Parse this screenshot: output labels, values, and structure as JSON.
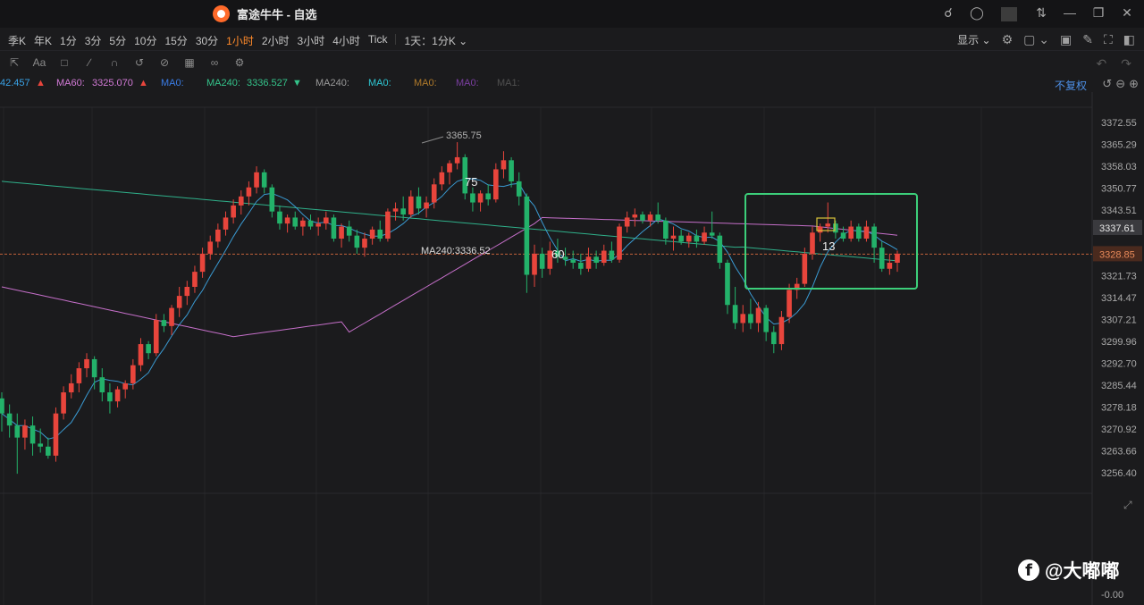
{
  "window": {
    "title": "富途牛牛 - 自选",
    "icons": [
      "headset-icon",
      "shirt-icon",
      "collapse-icon",
      "minimize-icon",
      "restore-icon",
      "close-icon"
    ]
  },
  "toolbar": {
    "timeframes": [
      "季K",
      "年K",
      "1分",
      "3分",
      "5分",
      "10分",
      "15分",
      "30分",
      "1小时",
      "2小时",
      "3小时",
      "4小时",
      "Tick"
    ],
    "active": "1小时",
    "range": "1天：1分K",
    "display": "显示"
  },
  "drawing_tools": [
    "text-icon",
    "comment-icon",
    "pen-icon",
    "magnet-icon",
    "sync-icon",
    "hide-icon",
    "trash-icon",
    "link-icon",
    "settings-icon"
  ],
  "indicators": {
    "items": [
      {
        "text": "42.457",
        "color": "#3aa3e8"
      },
      {
        "text": "▲",
        "color": "#e8453c"
      },
      {
        "text": "MA60:",
        "color": "#d27ad6"
      },
      {
        "text": "3325.070",
        "color": "#d27ad6"
      },
      {
        "text": "▲",
        "color": "#e8453c"
      },
      {
        "text": "MA0:",
        "color": "#3a7de8"
      },
      {
        "text": "MA240:",
        "color": "#34c38a"
      },
      {
        "text": "3336.527",
        "color": "#34c38a"
      },
      {
        "text": "▼",
        "color": "#34c38a"
      },
      {
        "text": "MA240:",
        "color": "#9a9a9a"
      },
      {
        "text": "MA0:",
        "color": "#2ec8d4"
      },
      {
        "text": "MA0:",
        "color": "#b07a2a"
      },
      {
        "text": "MA0:",
        "color": "#7a3ea0"
      },
      {
        "text": "MA1:",
        "color": "#505050"
      }
    ],
    "adjust": "不复权"
  },
  "chart_data": {
    "type": "candlestick",
    "price_axis": [
      "3372.55",
      "3365.29",
      "3358.03",
      "3350.77",
      "3343.51",
      "3337.61",
      "3328.85",
      "3321.73",
      "3314.47",
      "3307.21",
      "3299.96",
      "3292.70",
      "3285.44",
      "3278.18",
      "3270.92",
      "3263.66",
      "3256.40",
      "-0.00"
    ],
    "ylim": [
      3250,
      3378
    ],
    "current_price": "3328.85",
    "highlighted_price": "3337.61",
    "annotations": {
      "high_label": "3365.75",
      "ma240_label": "MA240:3336.52",
      "count_labels": [
        "75",
        "60",
        "13"
      ]
    },
    "highlight_box": "green rectangle around latest candles",
    "colors": {
      "up": "#e8453c",
      "down": "#23b26a",
      "ma60": "#c56fc9",
      "ma240": "#2fb08a",
      "ma_fast": "#3a9ad2"
    }
  }
}
